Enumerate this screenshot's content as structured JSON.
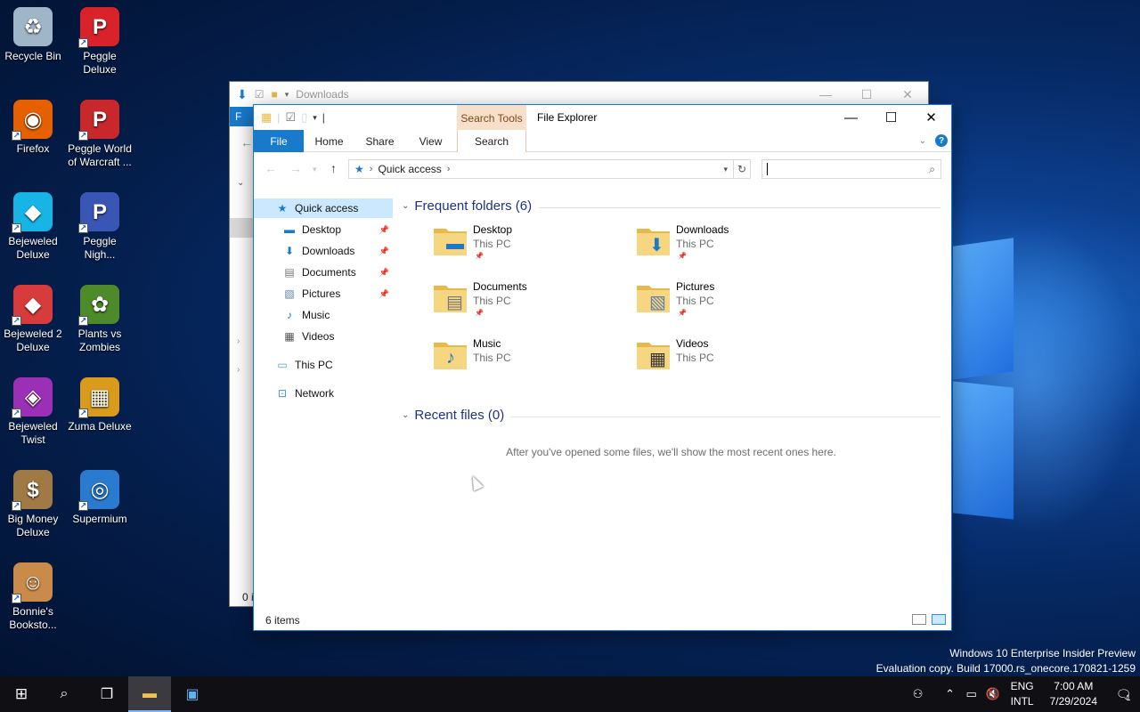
{
  "desktop": {
    "icons": [
      {
        "label": "Recycle Bin",
        "icon": "recycle-bin-icon",
        "color": "#9fb6c9"
      },
      {
        "label": "Peggle Deluxe",
        "icon": "peggle-icon",
        "color": "#d8232a"
      },
      {
        "label": "Firefox",
        "icon": "firefox-icon",
        "color": "#e66000"
      },
      {
        "label": "Peggle World of Warcraft ...",
        "icon": "peggle-wow-icon",
        "color": "#c8272b"
      },
      {
        "label": "Bejeweled Deluxe",
        "icon": "bejeweled-icon",
        "color": "#18b4e6"
      },
      {
        "label": "Peggle Nigh...",
        "icon": "peggle-nights-icon",
        "color": "#3a56b5"
      },
      {
        "label": "Bejeweled 2 Deluxe",
        "icon": "bejeweled2-icon",
        "color": "#d83b3b"
      },
      {
        "label": "Plants vs Zombies",
        "icon": "pvz-icon",
        "color": "#4d8a2a"
      },
      {
        "label": "Bejeweled Twist",
        "icon": "bejeweled-twist-icon",
        "color": "#9b2fb5"
      },
      {
        "label": "Zuma Deluxe",
        "icon": "zuma-icon",
        "color": "#d99a1d"
      },
      {
        "label": "Big Money Deluxe",
        "icon": "big-money-icon",
        "color": "#a07a45"
      },
      {
        "label": "Supermium",
        "icon": "supermium-icon",
        "color": "#2a7ad0"
      },
      {
        "label": "Bonnie's Booksto...",
        "icon": "bonnies-bookstore-icon",
        "color": "#c98a4a"
      }
    ],
    "watermark_line1": "Windows 10 Enterprise Insider Preview",
    "watermark_line2": "Evaluation copy. Build 17000.rs_onecore.170821-1259"
  },
  "back_window": {
    "title": "Downloads",
    "file_tab": "F",
    "status": "0 i"
  },
  "window": {
    "title": "File Explorer",
    "context_tab_group": "Search Tools",
    "tabs": {
      "file": "File",
      "home": "Home",
      "share": "Share",
      "view": "View",
      "search": "Search"
    },
    "address": {
      "location": "Quick access"
    },
    "search_value": "",
    "nav": [
      {
        "label": "Quick access",
        "icon": "star-icon",
        "pinned": false
      },
      {
        "label": "Desktop",
        "icon": "desktop-icon",
        "pinned": true
      },
      {
        "label": "Downloads",
        "icon": "download-icon",
        "pinned": true
      },
      {
        "label": "Documents",
        "icon": "document-icon",
        "pinned": true
      },
      {
        "label": "Pictures",
        "icon": "pictures-icon",
        "pinned": true
      },
      {
        "label": "Music",
        "icon": "music-icon",
        "pinned": false
      },
      {
        "label": "Videos",
        "icon": "video-icon",
        "pinned": false
      },
      {
        "label": "This PC",
        "icon": "computer-icon",
        "pinned": false
      },
      {
        "label": "Network",
        "icon": "network-icon",
        "pinned": false
      }
    ],
    "frequent_header": "Frequent folders (6)",
    "folders": [
      {
        "name": "Desktop",
        "location": "This PC",
        "pinned": true,
        "icon": "desktop-folder-icon"
      },
      {
        "name": "Downloads",
        "location": "This PC",
        "pinned": true,
        "icon": "downloads-folder-icon"
      },
      {
        "name": "Documents",
        "location": "This PC",
        "pinned": true,
        "icon": "documents-folder-icon"
      },
      {
        "name": "Pictures",
        "location": "This PC",
        "pinned": true,
        "icon": "pictures-folder-icon"
      },
      {
        "name": "Music",
        "location": "This PC",
        "pinned": false,
        "icon": "music-folder-icon"
      },
      {
        "name": "Videos",
        "location": "This PC",
        "pinned": false,
        "icon": "videos-folder-icon"
      }
    ],
    "recent_header": "Recent files (0)",
    "recent_message": "After you've opened some files, we'll show the most recent ones here.",
    "status": "6 items",
    "colors": {
      "accent": "#1979ca",
      "context_tab": "#f8dfc9",
      "group_header": "#1e3287",
      "selected": "#cce8ff"
    }
  },
  "taskbar": {
    "lang_top": "ENG",
    "lang_bottom": "INTL",
    "time": "7:00 AM",
    "date": "7/29/2024",
    "notification_count": "1"
  }
}
